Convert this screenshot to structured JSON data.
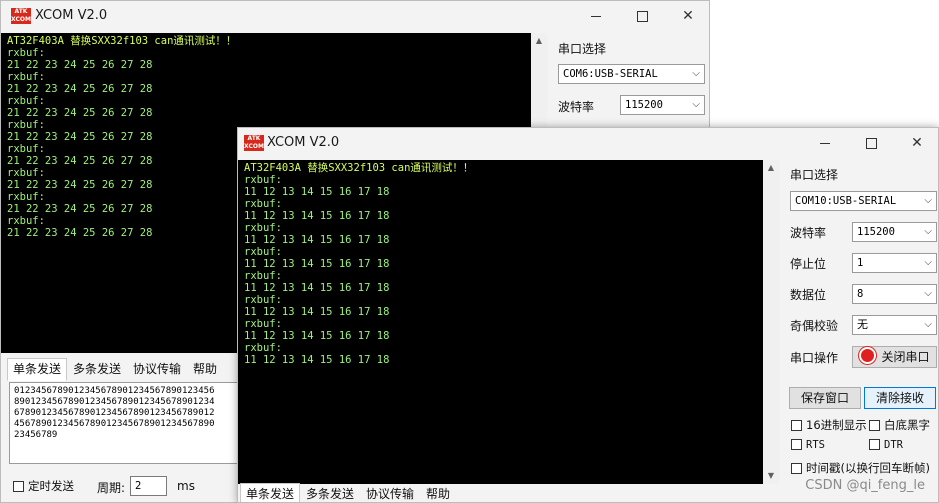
{
  "back": {
    "title": "XCOM V2.0",
    "logo_text": "ATK XCOM",
    "terminal_lines": [
      "AT32F403A 替换SXX32f103 can通讯测试！！",
      "rxbuf:",
      "21 22 23 24 25 26 27 28",
      "rxbuf:",
      "21 22 23 24 25 26 27 28",
      "rxbuf:",
      "21 22 23 24 25 26 27 28",
      "rxbuf:",
      "21 22 23 24 25 26 27 28",
      "rxbuf:",
      "21 22 23 24 25 26 27 28",
      "rxbuf:",
      "21 22 23 24 25 26 27 28",
      "rxbuf:",
      "21 22 23 24 25 26 27 28",
      "rxbuf:",
      "21 22 23 24 25 26 27 28"
    ],
    "port_label": "串口选择",
    "port_value": "COM6:USB-SERIAL",
    "baud_label": "波特率",
    "baud_value": "115200",
    "tabs": [
      "单条发送",
      "多条发送",
      "协议传输",
      "帮助"
    ],
    "send_text": "0123456789012345678901234567890123456\n8901234567890123456789012345678901234\n6789012345678901234567890123456789012\n4567890123456789012345678901234567890\n23456789",
    "timed_send_label": "定时发送",
    "period_label": "周期:",
    "period_value": "2",
    "period_unit": "ms"
  },
  "front": {
    "title": "XCOM V2.0",
    "logo_text": "ATK XCOM",
    "terminal_lines": [
      "AT32F403A 替换SXX32f103 can通讯测试！！",
      "rxbuf:",
      "11 12 13 14 15 16 17 18",
      "rxbuf:",
      "11 12 13 14 15 16 17 18",
      "rxbuf:",
      "11 12 13 14 15 16 17 18",
      "rxbuf:",
      "11 12 13 14 15 16 17 18",
      "rxbuf:",
      "11 12 13 14 15 16 17 18",
      "rxbuf:",
      "11 12 13 14 15 16 17 18",
      "rxbuf:",
      "11 12 13 14 15 16 17 18",
      "rxbuf:",
      "11 12 13 14 15 16 17 18"
    ],
    "port_label": "串口选择",
    "port_value": "COM10:USB-SERIAL",
    "baud_label": "波特率",
    "baud_value": "115200",
    "stopbits_label": "停止位",
    "stopbits_value": "1",
    "databits_label": "数据位",
    "databits_value": "8",
    "parity_label": "奇偶校验",
    "parity_value": "无",
    "op_label": "串口操作",
    "close_port_label": "关闭串口",
    "save_window_label": "保存窗口",
    "clear_recv_label": "清除接收",
    "hex_display_label": "16进制显示",
    "white_black_label": "白底黑字",
    "rts_label": "RTS",
    "dtr_label": "DTR",
    "timestamp_label": "时间戳(以换行回车断帧)",
    "tabs": [
      "单条发送",
      "多条发送",
      "协议传输",
      "帮助"
    ]
  },
  "watermark": "CSDN @qi_feng_le",
  "colors": {
    "terminal_bg": "#000000",
    "terminal_text": "#9df27b",
    "close_port_indicator": "#e02020"
  }
}
